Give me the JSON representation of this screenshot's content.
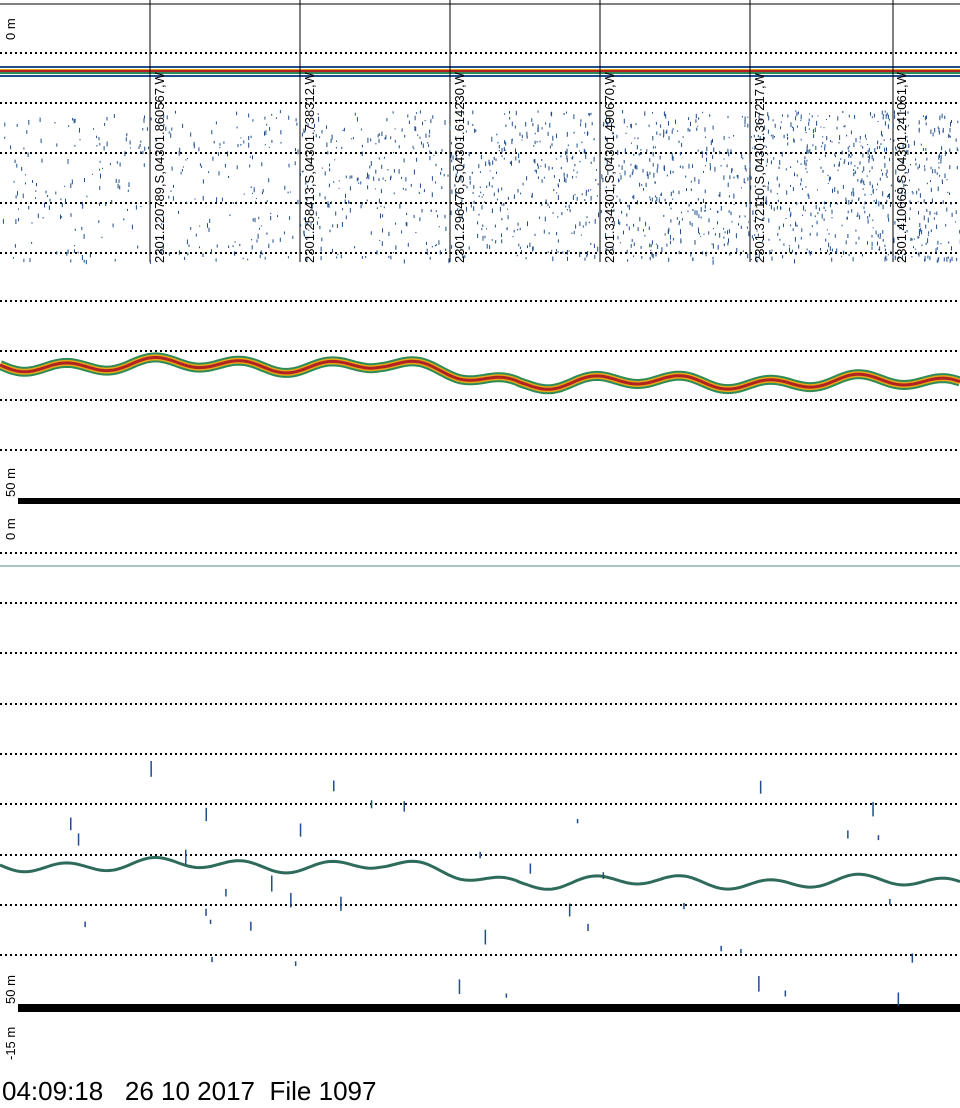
{
  "panels": [
    {
      "name": "upper-echogram",
      "top_depth_label": "0 m",
      "bottom_depth_label": "50 m"
    },
    {
      "name": "lower-echogram",
      "top_depth_label": "0 m",
      "bottom_depth_label": "50 m",
      "offset_label": "-15 m"
    }
  ],
  "positions": [
    "2301.220789,S,04301.860567,W",
    "2301.258413,S,04301.738312,W",
    "2301.296476,S,04301.614230,W",
    "2301.334301,S,04301.490670,W",
    "2301.372110,S,04301.367217,W",
    "2301.410669,S,04301.241061,W"
  ],
  "footer": {
    "time": "04:09:18",
    "date": "26 10 2017",
    "file": "File 1097"
  },
  "colors": {
    "background": "#ffffff",
    "grid": "#000000",
    "scatter": "#1f4e8c",
    "bottom_strong": "#b22222",
    "bottom_mid": "#e6a817",
    "bottom_weak": "#2e8b57"
  }
}
